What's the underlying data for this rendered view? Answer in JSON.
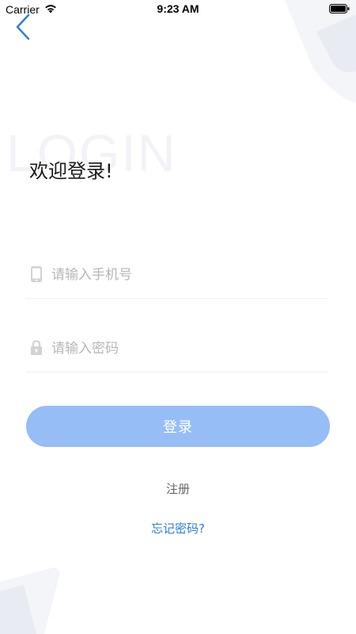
{
  "status_bar": {
    "carrier": "Carrier",
    "time": "9:23 AM",
    "icons": [
      "wifi-icon",
      "battery-icon"
    ]
  },
  "header": {
    "back_icon": "chevron-left-icon",
    "watermark": "LOGIN",
    "title": "欢迎登录!"
  },
  "form": {
    "phone": {
      "icon": "phone-icon",
      "placeholder": "请输入手机号",
      "value": ""
    },
    "password": {
      "icon": "lock-icon",
      "placeholder": "请输入密码",
      "value": ""
    },
    "login_label": "登录",
    "register_label": "注册",
    "forgot_label": "忘记密码?"
  },
  "colors": {
    "accent_blue": "#2f7fd8",
    "button_bg": "#97bdf6",
    "button_text": "#ffffff",
    "placeholder": "#b7b7b7",
    "watermark": "#f2f3f8"
  }
}
